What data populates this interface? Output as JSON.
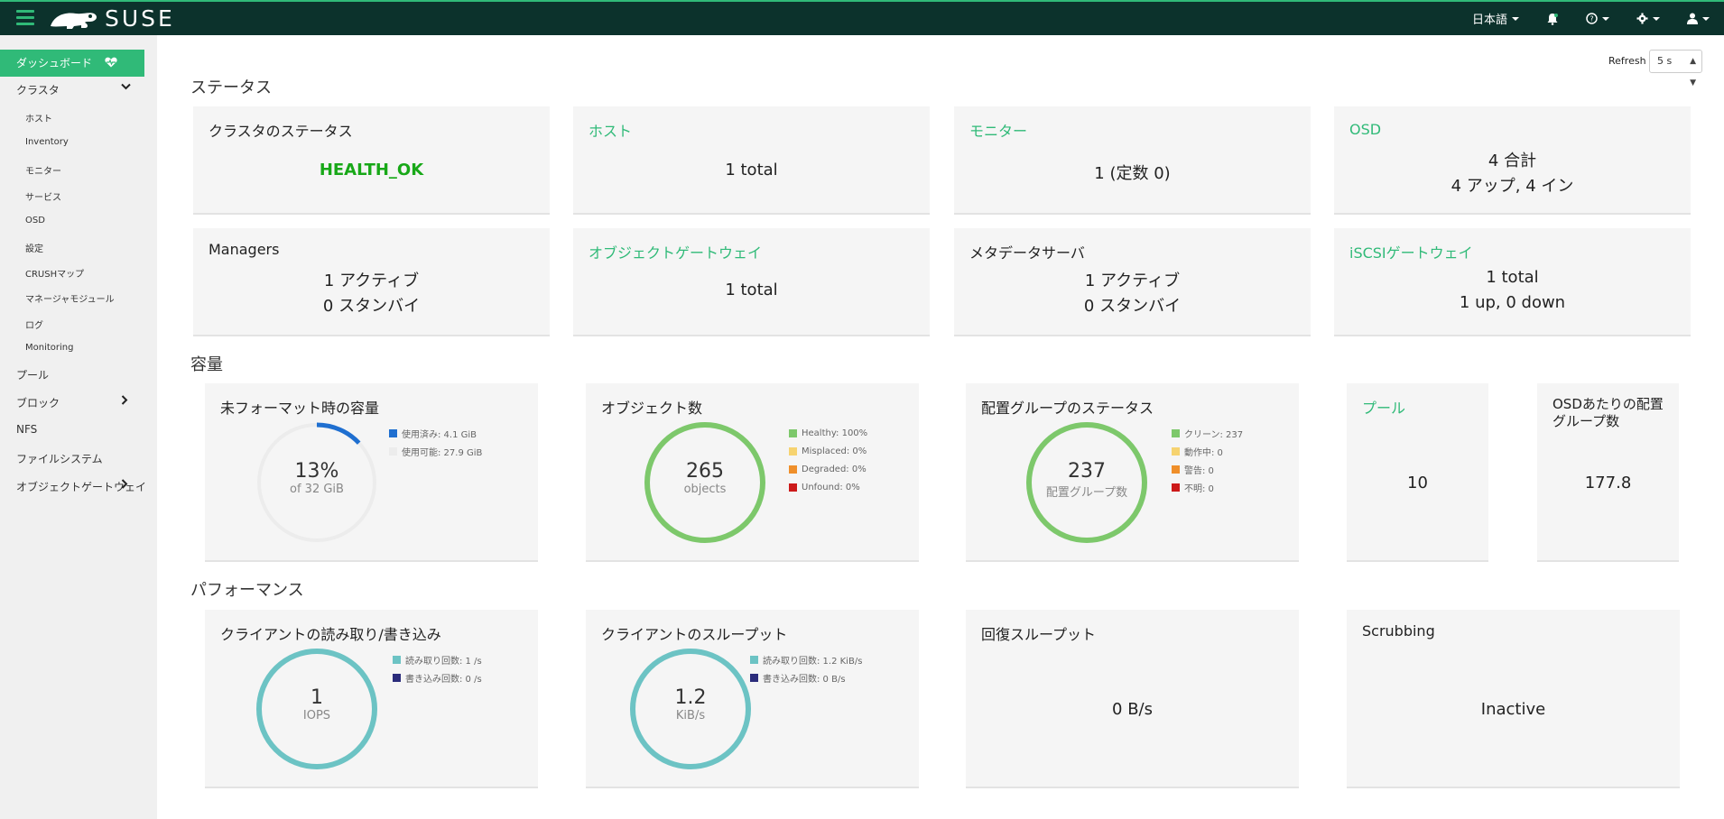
{
  "navbar": {
    "brand": "SUSE",
    "language": "日本語",
    "colors": {
      "bg": "#0c322c",
      "accent": "#30ba78"
    }
  },
  "sidebar": {
    "dashboard": "ダッシュボード",
    "cluster": "クラスタ",
    "cluster_items": [
      "ホスト",
      "Inventory",
      "モニター",
      "サービス",
      "OSD",
      "設定",
      "CRUSHマップ",
      "マネージャモジュール",
      "ログ",
      "Monitoring"
    ],
    "pool": "プール",
    "block": "ブロック",
    "nfs": "NFS",
    "filesystem": "ファイルシステム",
    "object_gateway": "オブジェクトゲートウェイ"
  },
  "refresh": {
    "label": "Refresh",
    "value": "5 s"
  },
  "sections": {
    "status": "ステータス",
    "capacity": "容量",
    "performance": "パフォーマンス"
  },
  "status": {
    "cluster_status": {
      "title": "クラスタのステータス",
      "value": "HEALTH_OK"
    },
    "hosts": {
      "title": "ホスト",
      "value": "1 total"
    },
    "monitors": {
      "title": "モニター",
      "value": "1 (定数 0)"
    },
    "osd": {
      "title": "OSD",
      "line1": "4 合計",
      "line2": "4 アップ, 4 イン"
    },
    "managers": {
      "title": "Managers",
      "line1": "1 アクティブ",
      "line2": "0 スタンバイ"
    },
    "object_gateway": {
      "title": "オブジェクトゲートウェイ",
      "value": "1 total"
    },
    "metadata_servers": {
      "title": "メタデータサーバ",
      "line1": "1 アクティブ",
      "line2": "0 スタンバイ"
    },
    "iscsi": {
      "title": "iSCSIゲートウェイ",
      "line1": "1 total",
      "line2": "1 up, 0 down"
    }
  },
  "capacity": {
    "raw": {
      "title": "未フォーマット時の容量",
      "percent": "13%",
      "sub": "of 32 GiB",
      "used_fraction": 0.13,
      "legend": [
        "使用済み: 4.1 GiB",
        "使用可能: 27.9 GiB"
      ],
      "colors": [
        "#1f6fd0",
        "#ececec"
      ]
    },
    "objects": {
      "title": "オブジェクト数",
      "value": "265",
      "sub": "objects",
      "legend": [
        "Healthy: 100%",
        "Misplaced: 0%",
        "Degraded: 0%",
        "Unfound: 0%"
      ],
      "colors": [
        "#7dc86b",
        "#f6d370",
        "#ef8f2a",
        "#cc1a1a"
      ]
    },
    "pg_status": {
      "title": "配置グループのステータス",
      "value": "237",
      "sub": "配置グループ数",
      "legend": [
        "クリーン: 237",
        "動作中: 0",
        "警告: 0",
        "不明: 0"
      ],
      "colors": [
        "#7dc86b",
        "#f6d370",
        "#ef8f2a",
        "#cc1a1a"
      ]
    },
    "pools": {
      "title": "プール",
      "value": "10"
    },
    "pg_per_osd": {
      "title": "OSDあたりの配置グループ数",
      "value": "177.8"
    }
  },
  "performance": {
    "client_rw": {
      "title": "クライアントの読み取り/書き込み",
      "value": "1",
      "sub": "IOPS",
      "legend": [
        "読み取り回数: 1 /s",
        "書き込み回数: 0 /s"
      ],
      "colors": [
        "#6cc3c4",
        "#2b2c7b"
      ]
    },
    "client_throughput": {
      "title": "クライアントのスループット",
      "value": "1.2",
      "sub": "KiB/s",
      "legend": [
        "読み取り回数: 1.2 KiB/s",
        "書き込み回数: 0 B/s"
      ],
      "colors": [
        "#6cc3c4",
        "#2b2c7b"
      ]
    },
    "recovery": {
      "title": "回復スループット",
      "value": "0 B/s"
    },
    "scrubbing": {
      "title": "Scrubbing",
      "value": "Inactive"
    }
  }
}
